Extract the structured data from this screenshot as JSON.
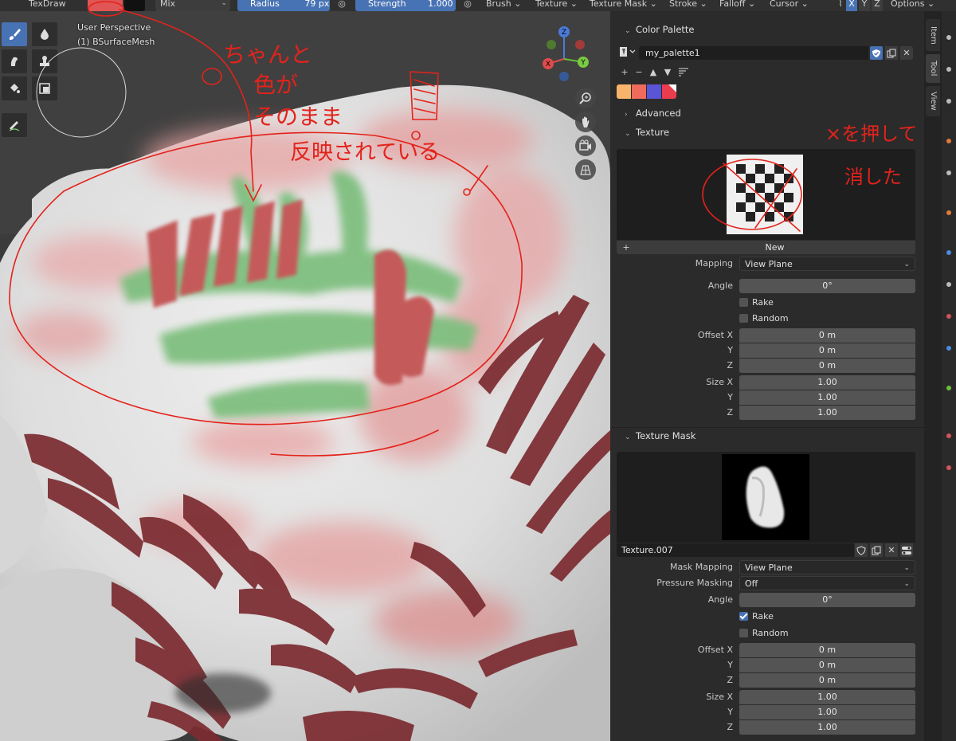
{
  "header": {
    "mode": "TexDraw",
    "blend": "Mix",
    "radius_label": "Radius",
    "radius_value": "79 px",
    "strength_label": "Strength",
    "strength_value": "1.000",
    "menus": [
      "Brush",
      "Texture",
      "Texture Mask",
      "Stroke",
      "Falloff",
      "Cursor"
    ],
    "axes": [
      "X",
      "Y",
      "Z"
    ],
    "options": "Options"
  },
  "viewport": {
    "perspective": "User Perspective",
    "object": "(1) BSurfaceMesh",
    "gizmo_axes": [
      "X",
      "Y",
      "Z"
    ]
  },
  "side_tabs": [
    "Item",
    "Tool",
    "View"
  ],
  "color_palette": {
    "title": "Color Palette",
    "palette_name": "my_palette1",
    "swatches": [
      "#f7b46a",
      "#ef6b5c",
      "#5a55d6",
      "#ea3c4e"
    ]
  },
  "advanced": {
    "title": "Advanced"
  },
  "texture": {
    "title": "Texture",
    "new_button": "New",
    "mapping_label": "Mapping",
    "mapping_value": "View Plane",
    "angle_label": "Angle",
    "angle_value": "0°",
    "rake_label": "Rake",
    "random_label": "Random",
    "offset": {
      "labels": [
        "Offset X",
        "Y",
        "Z"
      ],
      "values": [
        "0 m",
        "0 m",
        "0 m"
      ]
    },
    "size": {
      "labels": [
        "Size X",
        "Y",
        "Z"
      ],
      "values": [
        "1.00",
        "1.00",
        "1.00"
      ]
    }
  },
  "texture_mask": {
    "title": "Texture Mask",
    "name": "Texture.007",
    "mask_mapping_label": "Mask Mapping",
    "mask_mapping_value": "View Plane",
    "pressure_label": "Pressure Masking",
    "pressure_value": "Off",
    "angle_label": "Angle",
    "angle_value": "0°",
    "rake_label": "Rake",
    "rake_checked": true,
    "random_label": "Random",
    "offset": {
      "labels": [
        "Offset X",
        "Y",
        "Z"
      ],
      "values": [
        "0 m",
        "0 m",
        "0 m"
      ]
    },
    "size": {
      "labels": [
        "Size X",
        "Y",
        "Z"
      ],
      "values": [
        "1.00",
        "1.00",
        "1.00"
      ]
    }
  },
  "annotations": {
    "note_left": [
      "ちゃんと",
      "色が",
      "そのまま",
      "反映されている"
    ],
    "note_right_top": "×を押して",
    "note_right_bottom": "消した",
    "color": "#e3231b"
  }
}
